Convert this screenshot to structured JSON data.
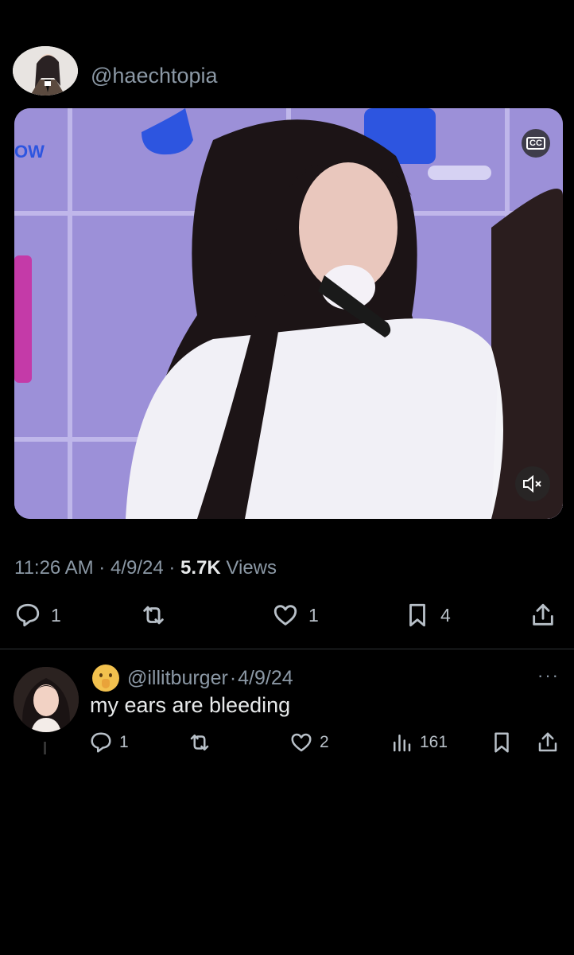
{
  "tweet": {
    "handle": "@haechtopia",
    "media": {
      "cc_label": "CC",
      "mute_state": "muted"
    },
    "time": "11:26 AM",
    "date": "4/9/24",
    "views_count": "5.7K",
    "views_label": "Views",
    "separator": "·",
    "actions": {
      "reply_count": "1",
      "retweet_count": "",
      "like_count": "1",
      "bookmark_count": "4"
    }
  },
  "reply": {
    "handle": "@illitburger",
    "date": "4/9/24",
    "separator": "·",
    "emoji": "shushing-face",
    "more": "···",
    "text": "my ears are bleeding",
    "actions": {
      "reply_count": "1",
      "retweet_count": "",
      "like_count": "2",
      "views_count": "161"
    }
  },
  "colors": {
    "background": "#000000",
    "text": "#e7e9ea",
    "muted": "#8b98a5",
    "divider": "#2f3336"
  }
}
